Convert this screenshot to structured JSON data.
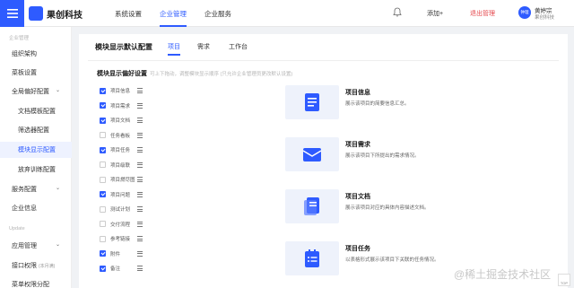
{
  "brand": {
    "name": "果创科技",
    "accent": "#2e5bff"
  },
  "topnav": {
    "items": [
      "系统设置",
      "企业管理",
      "企业服务"
    ],
    "active_index": 1,
    "add_label": "添加+",
    "logout_label": "退出管理",
    "user": {
      "avatar_text": "钟理",
      "name": "黄婷宗",
      "org": "果创科技"
    }
  },
  "sidebar": {
    "group1": "企业管理",
    "items": [
      {
        "label": "组织架构"
      },
      {
        "label": "菜板设置"
      },
      {
        "label": "全局偏好配置",
        "expanded": true
      },
      {
        "label": "文档模板配置"
      },
      {
        "label": "筛选器配置"
      },
      {
        "label": "模块显示配置",
        "active": true
      },
      {
        "label": "放弃训练配置"
      },
      {
        "label": "服务配置",
        "expanded": true
      },
      {
        "label": "企业信息"
      }
    ],
    "group2": "Update",
    "items2": [
      {
        "label": "应用管理",
        "expanded": true
      },
      {
        "label": "接口权限",
        "tag": "(本月满)"
      },
      {
        "label": "菜单权限分配"
      }
    ]
  },
  "panel": {
    "title": "模块显示默认配置",
    "tabs": [
      "项目",
      "需求",
      "工作台"
    ],
    "active_tab": 0,
    "pref_label": "模块显示偏好设置",
    "pref_hint": "可上下拖动，调整模块显示顺序 (只允许企业管理员更改默认设置)",
    "modules": [
      {
        "label": "项目信息",
        "checked": true
      },
      {
        "label": "项目需求",
        "checked": true
      },
      {
        "label": "项目文档",
        "checked": true
      },
      {
        "label": "任务看板",
        "checked": false
      },
      {
        "label": "项目任务",
        "checked": true
      },
      {
        "label": "项目级联",
        "checked": false
      },
      {
        "label": "项目燃尽图",
        "checked": false
      },
      {
        "label": "项目问题",
        "checked": true
      },
      {
        "label": "测试计划",
        "checked": false
      },
      {
        "label": "交付流程",
        "checked": false
      },
      {
        "label": "参考链接",
        "checked": false
      },
      {
        "label": "附件",
        "checked": true
      },
      {
        "label": "备注",
        "checked": true
      }
    ],
    "cards": [
      {
        "title": "项目信息",
        "desc": "展示该项目的简要信息汇总。"
      },
      {
        "title": "项目需求",
        "desc": "展示该项目下所提出的需求情况。"
      },
      {
        "title": "项目文档",
        "desc": "展示该项目对应的具体内容描述文档。"
      },
      {
        "title": "项目任务",
        "desc": "以表格形式展示该项目下关联的任务情况。"
      }
    ]
  },
  "watermark": "@稀土掘金技术社区",
  "top_button": "TOP"
}
